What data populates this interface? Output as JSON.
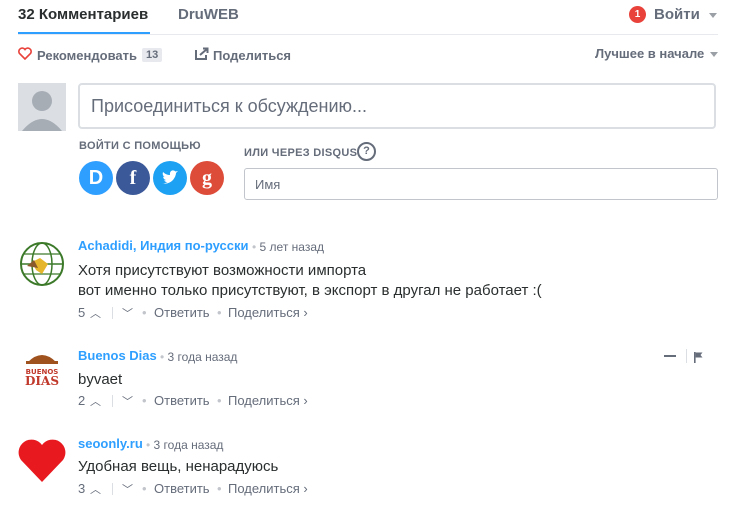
{
  "nav": {
    "comments_count_label": "32 Комментариев",
    "site_name": "DruWEB",
    "notifications": "1",
    "login_label": "Войти"
  },
  "toolbar": {
    "recommend_label": "Рекомендовать",
    "recommend_count": "13",
    "share_label": "Поделиться",
    "sort_label": "Лучшее в начале"
  },
  "composer": {
    "placeholder": "Присоединиться к обсуждению...",
    "login_with": "ВОЙТИ С ПОМОЩЬЮ",
    "or_via_disqus": "ИЛИ ЧЕРЕЗ DISQUS",
    "name_placeholder": "Имя",
    "providers": [
      {
        "icon": "disqus-icon",
        "glyph": "D",
        "color": "#2e9fff"
      },
      {
        "icon": "facebook-icon",
        "glyph": "f",
        "color": "#3b5998"
      },
      {
        "icon": "twitter-icon",
        "glyph": "t",
        "color": "#1da1f2"
      },
      {
        "icon": "google-icon",
        "glyph": "g",
        "color": "#dd4b39"
      }
    ]
  },
  "comments": [
    {
      "author": "Achadidi, Индия по-русски",
      "time": "5 лет назад",
      "lines": [
        "Хотя присутствуют возможности импорта",
        "вот именно только присутствуют, в экспорт в другал не работает :("
      ],
      "votes": "5",
      "reply": "Ответить",
      "share": "Поделиться ›"
    },
    {
      "author": "Buenos Dias",
      "time": "3 года назад",
      "lines": [
        "byvaet"
      ],
      "votes": "2",
      "reply": "Ответить",
      "share": "Поделиться ›",
      "avatar_text": "BUENOS DIAS"
    },
    {
      "author": "seoonly.ru",
      "time": "3 года назад",
      "lines": [
        "Удобная вещь, ненарадуюсь"
      ],
      "votes": "3",
      "reply": "Ответить",
      "share": "Поделиться ›"
    }
  ],
  "colors": {
    "accent": "#2e9fff",
    "text": "#2a2e2e",
    "muted": "#656c7a",
    "badge": "#e8423a"
  }
}
